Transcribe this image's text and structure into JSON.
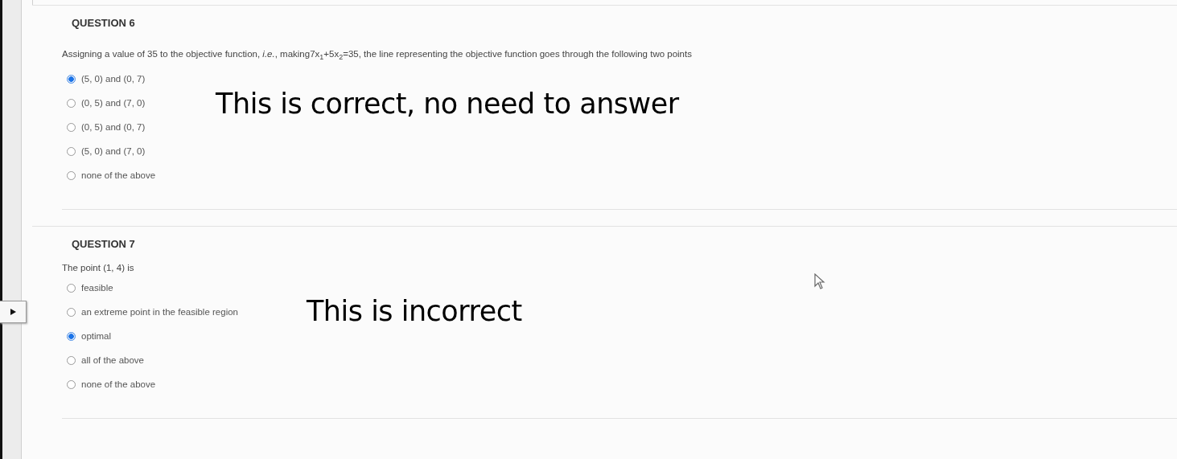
{
  "questions": [
    {
      "heading": "QUESTION 6",
      "prompt": "Assigning a value of 35 to the objective function, *i.e.*, making7x$_{1}$+5x$_{2}$=35, the line representing the objective function goes through the following two points",
      "options": [
        {
          "label": "(5, 0) and (0, 7)",
          "selected": true
        },
        {
          "label": "(0, 5) and (7, 0)",
          "selected": false
        },
        {
          "label": "(0, 5) and (0, 7)",
          "selected": false
        },
        {
          "label": "(5, 0) and (7, 0)",
          "selected": false
        },
        {
          "label": "none of the above",
          "selected": false
        }
      ],
      "annotation": "This is correct, no need to answer"
    },
    {
      "heading": "QUESTION 7",
      "prompt": "The point (1, 4) is",
      "options": [
        {
          "label": "feasible",
          "selected": false
        },
        {
          "label": "an extreme point in the feasible region",
          "selected": false
        },
        {
          "label": "optimal",
          "selected": true
        },
        {
          "label": "all of the above",
          "selected": false
        },
        {
          "label": "none of the above",
          "selected": false
        }
      ],
      "annotation": "This is incorrect"
    }
  ]
}
